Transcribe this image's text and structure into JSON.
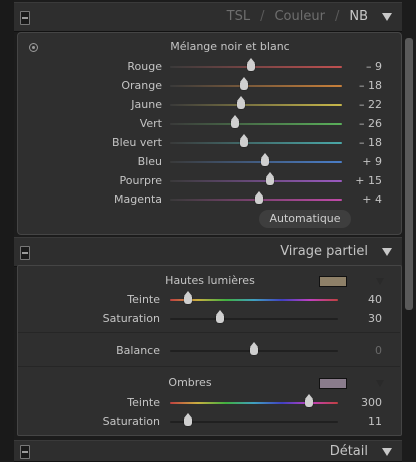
{
  "tabs": {
    "tsl": "TSL",
    "couleur": "Couleur",
    "nb": "NB",
    "separator": "/"
  },
  "bw_mix": {
    "title": "Mélange noir et blanc",
    "sliders": [
      {
        "label": "Rouge",
        "value": "– 9",
        "level": 0.47,
        "track_colors": [
          "#3a3a3a",
          "#c05050"
        ]
      },
      {
        "label": "Orange",
        "value": "– 18",
        "level": 0.43,
        "track_colors": [
          "#3a3a3a",
          "#c8803a"
        ]
      },
      {
        "label": "Jaune",
        "value": "– 22",
        "level": 0.41,
        "track_colors": [
          "#3a3a3a",
          "#c8b84a"
        ]
      },
      {
        "label": "Vert",
        "value": "– 26",
        "level": 0.38,
        "track_colors": [
          "#3a3a3a",
          "#5ab05a"
        ]
      },
      {
        "label": "Bleu vert",
        "value": "– 18",
        "level": 0.43,
        "track_colors": [
          "#3a3a3a",
          "#4aa8a8"
        ]
      },
      {
        "label": "Bleu",
        "value": "+ 9",
        "level": 0.55,
        "track_colors": [
          "#3a3a3a",
          "#4a7ec8"
        ]
      },
      {
        "label": "Pourpre",
        "value": "+ 15",
        "level": 0.58,
        "track_colors": [
          "#3a3a3a",
          "#9a5ac0"
        ]
      },
      {
        "label": "Magenta",
        "value": "+ 4",
        "level": 0.52,
        "track_colors": [
          "#3a3a3a",
          "#c04aa8"
        ]
      }
    ],
    "auto_button": "Automatique"
  },
  "split_toning": {
    "header": "Virage partiel",
    "highlights": {
      "title": "Hautes lumières",
      "swatch": "#8e8068",
      "hue": {
        "label": "Teinte",
        "value": "40",
        "level": 0.11
      },
      "saturation": {
        "label": "Saturation",
        "value": "30",
        "level": 0.3
      }
    },
    "balance": {
      "label": "Balance",
      "value": "0",
      "level": 0.5
    },
    "shadows": {
      "title": "Ombres",
      "swatch": "#8a7c8c",
      "hue": {
        "label": "Teinte",
        "value": "300",
        "level": 0.83
      },
      "saturation": {
        "label": "Saturation",
        "value": "11",
        "level": 0.11
      }
    }
  },
  "detail": {
    "header": "Détail"
  },
  "icons": {
    "target": "target-adjustment-icon",
    "collapse": "triangle-down-icon",
    "switch": "panel-switch-icon"
  }
}
